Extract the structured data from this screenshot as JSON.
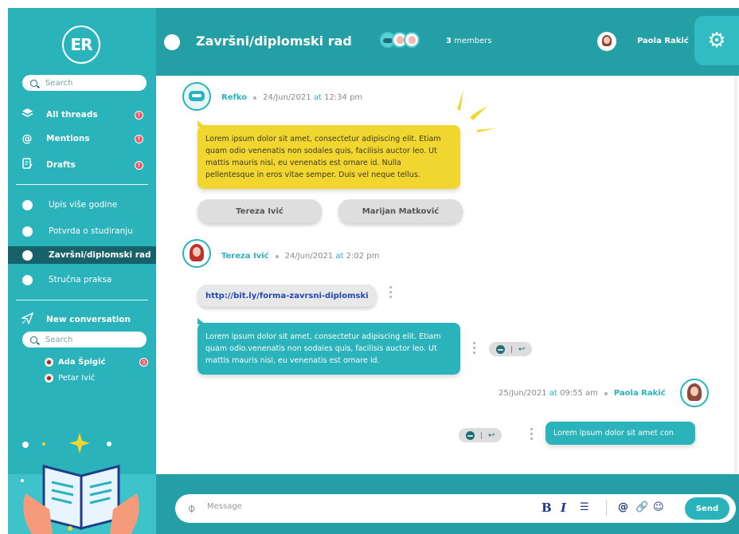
{
  "sidebar": {
    "logo_text": "ER",
    "search_placeholder": "Search",
    "nav": [
      {
        "label": "All threads",
        "icon": "layers-icon",
        "badge": "!"
      },
      {
        "label": "Mentions",
        "icon": "at-icon",
        "badge": "!"
      },
      {
        "label": "Drafts",
        "icon": "drafts-icon",
        "badge": "!"
      }
    ],
    "threads": [
      {
        "label": "Upis više godine"
      },
      {
        "label": "Potvrda o studiranju"
      },
      {
        "label": "Završni/diplomski rad",
        "active": true
      },
      {
        "label": "Stručna praksa"
      }
    ],
    "new_conversation": "New conversation",
    "contacts_search_placeholder": "Search",
    "contacts": [
      {
        "name": "Ada Špigić",
        "badge": "3",
        "bold": true
      },
      {
        "name": "Petar Ivić",
        "badge": "",
        "bold": false
      }
    ]
  },
  "header": {
    "title": "Završni/diplomski rad",
    "members_count": "3",
    "members_label": "members",
    "user_name": "Paola Rakić"
  },
  "messages": [
    {
      "author": "Refko",
      "date": "24/Jun/2021",
      "at": "at",
      "time": "12:34 pm",
      "text": "Lorem ipsum dolor sit amet, consectetur adipiscing elit. Etiam quam odio venenatis non sodales quis, facilisis auctor leo. Ut mattis mauris nisi, eu venenatis est ornare id. Nulla pellentesque in eros vitae semper. Duis vel neque tellus.",
      "options": [
        "Tereza Ivić",
        "Marijan Matković"
      ]
    },
    {
      "author": "Tereza Ivić",
      "date": "24/Jun/2021",
      "at": "at",
      "time": "2:02 pm",
      "link": "http://bit.ly/forma-zavrsni-diplomski",
      "text": "Lorem ipsum dolor sit amet, consectetur adipiscing elit. Etiam quam odio.venenatis non sodales quis, facilisis auctor leo. Ut mattis mauris nisi, eu venenatis est ornare id."
    },
    {
      "author": "Paola Rakić",
      "date": "25/Jun/2021",
      "at": "at",
      "time": "09:55 am",
      "text": "Lorem ipsum dolor sit amet con"
    }
  ],
  "composer": {
    "placeholder": "Message",
    "send_label": "Send",
    "bold": "B",
    "italic": "I",
    "list": "☰",
    "align": "☰",
    "mention": "@",
    "link": "🔗",
    "emoji": "☺"
  },
  "colors": {
    "sidebar": "#2ab3bb",
    "header": "#249fa6",
    "active_thread": "#16616a",
    "bot_bubble": "#f2d630",
    "user_bubble": "#2ab3bb",
    "badge": "#ec5b67"
  }
}
